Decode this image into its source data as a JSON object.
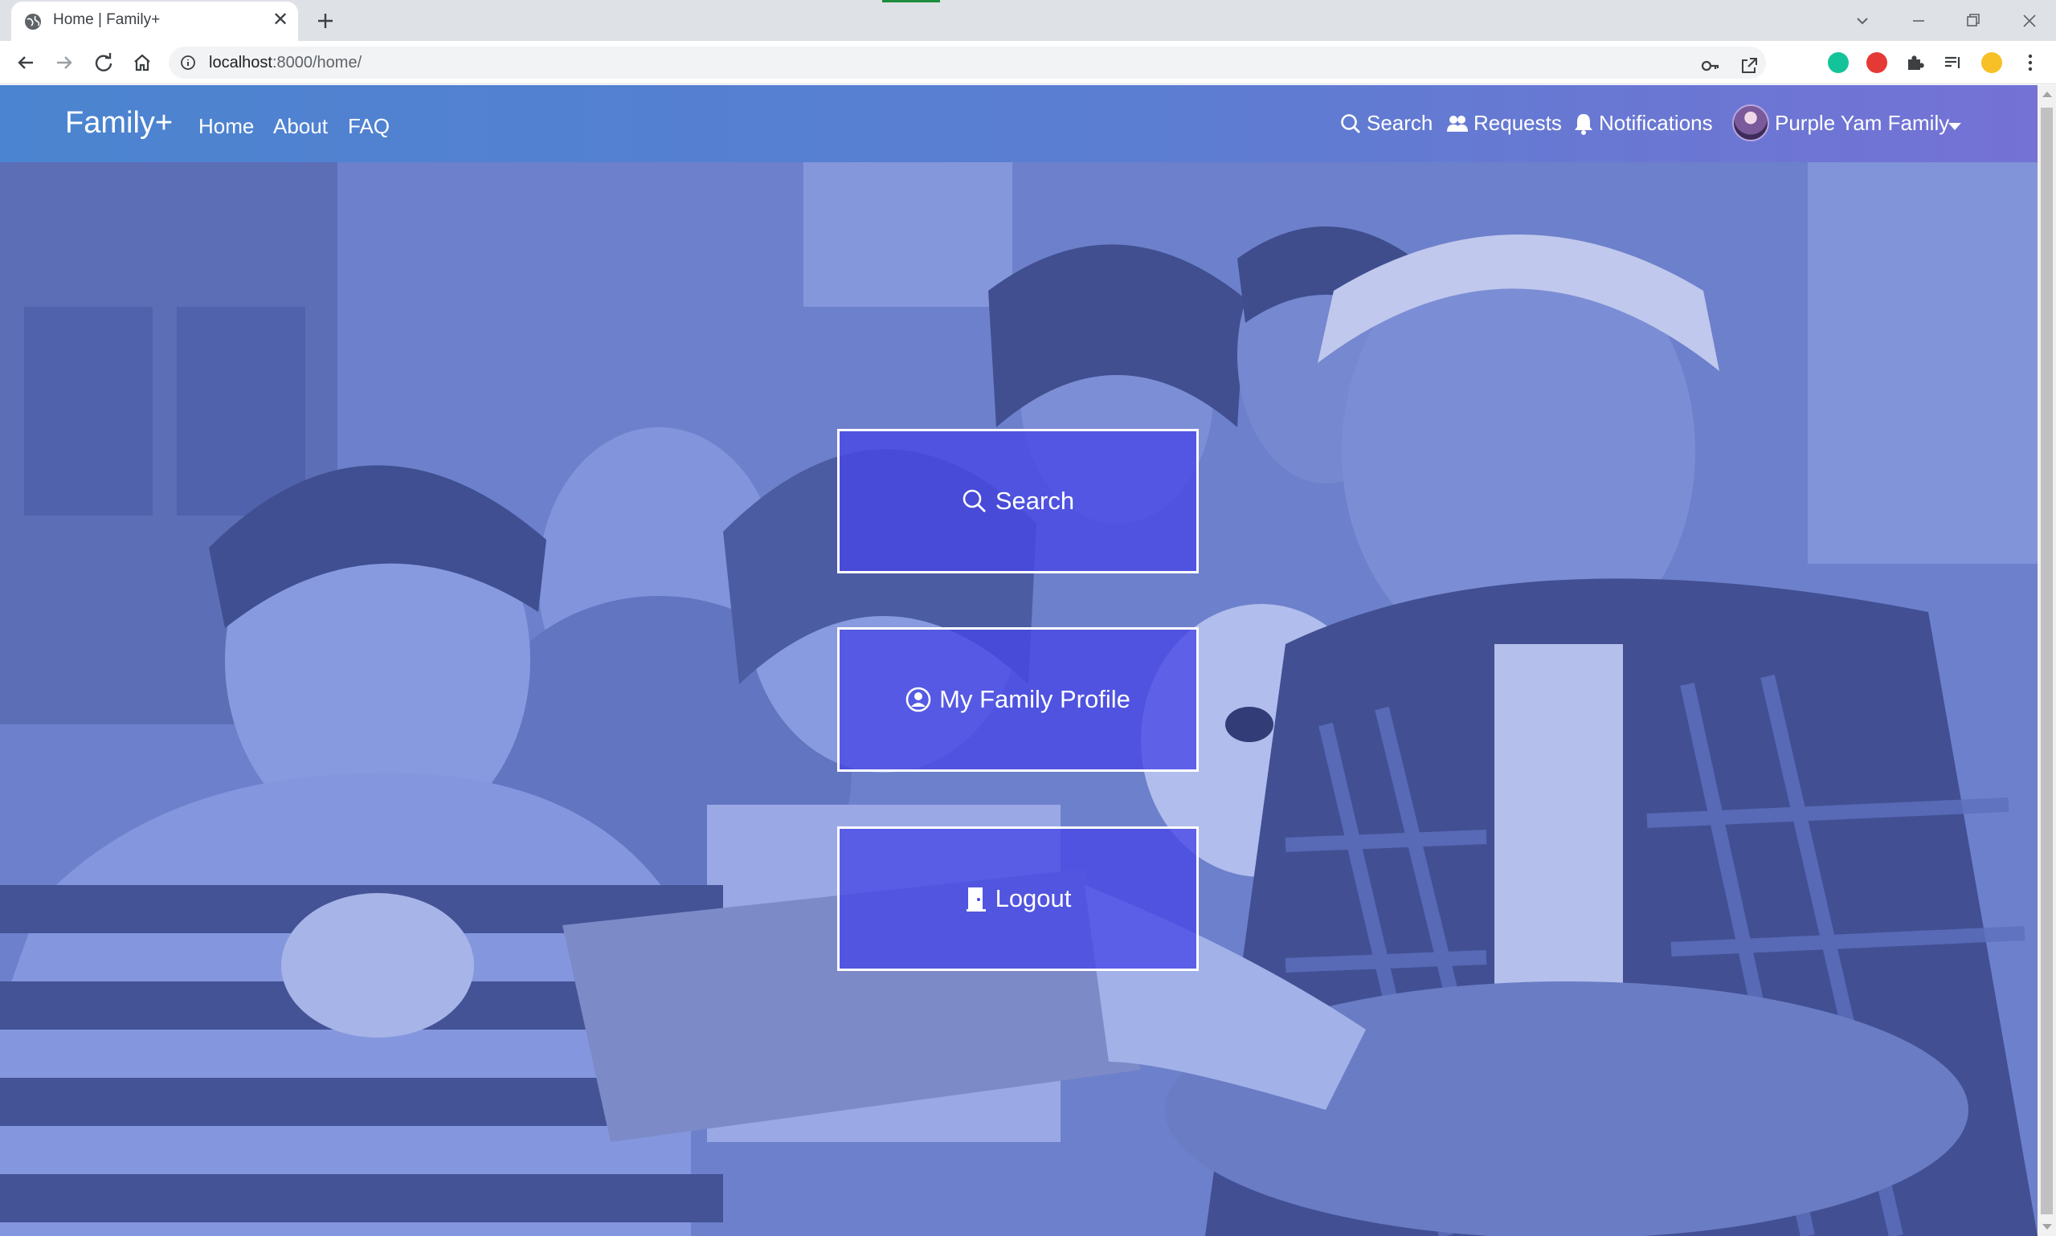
{
  "browser": {
    "tab_title": "Home | Family+",
    "tab_close": "✕",
    "url_host": "localhost",
    "url_path": ":8000/home/"
  },
  "navbar": {
    "brand": "Family+",
    "links": [
      "Home",
      "About",
      "FAQ"
    ],
    "right": {
      "search": "Search",
      "requests": "Requests",
      "notifications": "Notifications",
      "user": "Purple Yam Family"
    }
  },
  "actions": {
    "search": "Search",
    "profile": "My Family Profile",
    "logout": "Logout"
  },
  "colors": {
    "navbar_start": "#4b84d0",
    "navbar_end": "#7472d4",
    "button_fill": "#4646e6",
    "hero_tint": "#6e82c8"
  },
  "icons": {
    "search": "magnifier-icon",
    "requests": "users-icon",
    "notifications": "bell-icon",
    "profile": "user-circle-icon",
    "logout": "door-icon"
  }
}
